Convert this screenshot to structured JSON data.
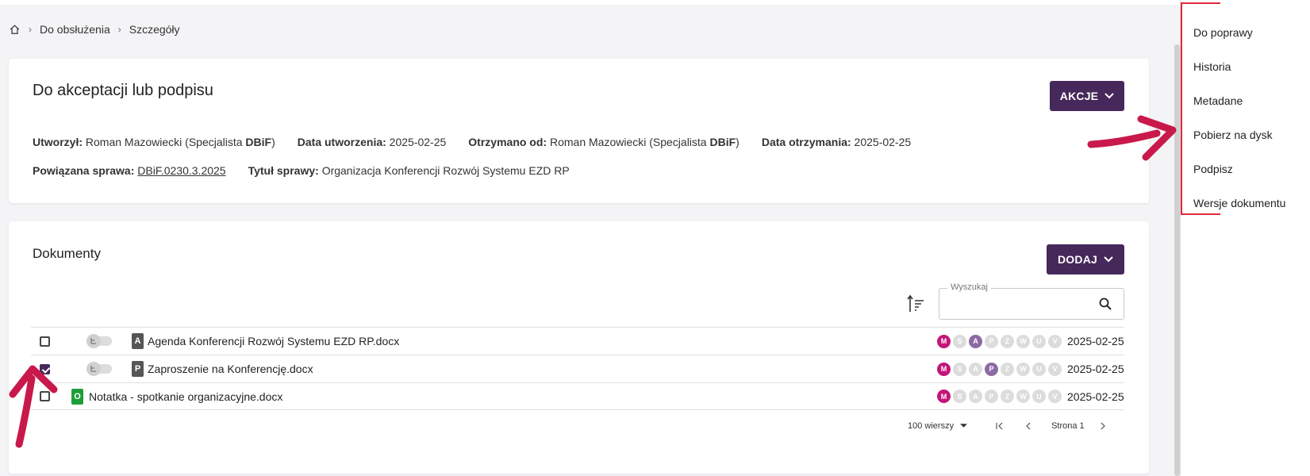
{
  "breadcrumb": {
    "items": [
      "Do obsłużenia",
      "Szczegóły"
    ]
  },
  "header_card": {
    "title": "Do akceptacji lub podpisu",
    "actions_label": "AKCJE",
    "meta": {
      "created_by_label": "Utworzył:",
      "created_by_name": "Roman Mazowiecki (Specjalista ",
      "created_by_unit": "DBiF",
      "created_by_close": ")",
      "created_date_label": "Data utworzenia:",
      "created_date": "2025-02-25",
      "received_from_label": "Otrzymano od:",
      "received_from_name": "Roman Mazowiecki (Specjalista ",
      "received_from_unit": "DBiF",
      "received_from_close": ")",
      "received_date_label": "Data otrzymania:",
      "received_date": "2025-02-25",
      "case_label": "Powiązana sprawa:",
      "case_value": "DBiF.0230.3.2025",
      "case_title_label": "Tytuł sprawy:",
      "case_title": "Organizacja Konferencji Rozwój Systemu EZD RP"
    }
  },
  "documents_card": {
    "title": "Dokumenty",
    "add_label": "DODAJ",
    "search": {
      "label": "Wyszukaj",
      "value": ""
    },
    "rows": [
      {
        "checked": false,
        "type": "A",
        "name": "Agenda Konferencji Rozwój Systemu EZD RP.docx",
        "date": "2025-02-25",
        "statuses": [
          "M",
          "S",
          "A",
          "P",
          "Z",
          "W",
          "U",
          "V"
        ],
        "active": "A"
      },
      {
        "checked": true,
        "type": "P",
        "name": "Zaproszenie na Konferencję.docx",
        "date": "2025-02-25",
        "statuses": [
          "M",
          "S",
          "A",
          "P",
          "Z",
          "W",
          "U",
          "V"
        ],
        "active": "P"
      },
      {
        "checked": false,
        "type": "O",
        "name": "Notatka - spotkanie organizacyjne.docx",
        "date": "2025-02-25",
        "statuses": [
          "M",
          "S",
          "A",
          "P",
          "Z",
          "W",
          "U",
          "V"
        ],
        "active": ""
      }
    ],
    "pagination": {
      "rows_per_page": "100 wierszy",
      "page_label": "Strona 1"
    }
  },
  "side_menu": {
    "items": [
      "Do poprawy",
      "Historia",
      "Metadane",
      "Pobierz na dysk",
      "Podpisz",
      "Wersje dokumentu"
    ]
  },
  "colors": {
    "primary": "#46285a",
    "status_m": "#c3157a",
    "status_active": "#8c6ba3",
    "annotation": "#c8194a",
    "type_o": "#1e9e3a"
  }
}
